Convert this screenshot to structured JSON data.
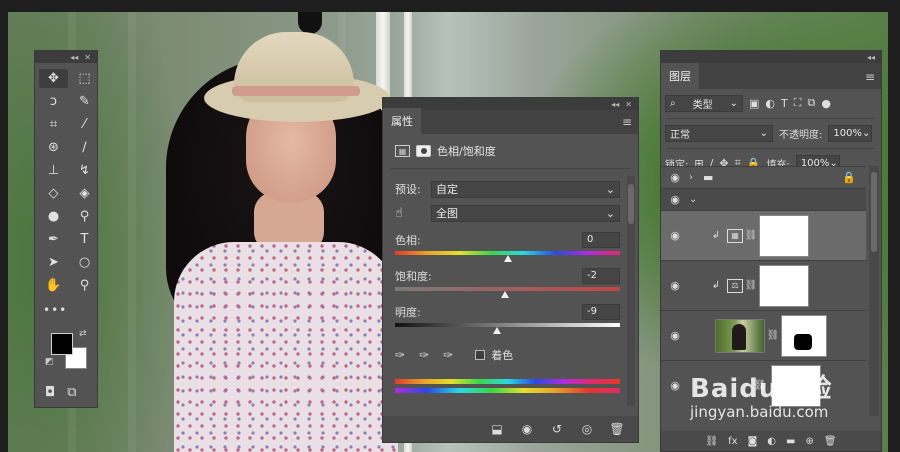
{
  "tools_panel": {
    "collapse_label": "◂◂",
    "close_label": "✕",
    "tools": [
      {
        "icon": "move-icon",
        "glyph": "✥",
        "active": true
      },
      {
        "icon": "marquee-icon",
        "glyph": "⬚"
      },
      {
        "icon": "lasso-icon",
        "glyph": "ↄ"
      },
      {
        "icon": "quick-select-icon",
        "glyph": "✎"
      },
      {
        "icon": "crop-icon",
        "glyph": "⌗"
      },
      {
        "icon": "eyedropper-icon",
        "glyph": "⁄"
      },
      {
        "icon": "healing-brush-icon",
        "glyph": "⊛"
      },
      {
        "icon": "brush-icon",
        "glyph": "∕"
      },
      {
        "icon": "clone-stamp-icon",
        "glyph": "⊥"
      },
      {
        "icon": "history-brush-icon",
        "glyph": "↯"
      },
      {
        "icon": "eraser-icon",
        "glyph": "◇"
      },
      {
        "icon": "paint-bucket-icon",
        "glyph": "◈"
      },
      {
        "icon": "blur-icon",
        "glyph": "●"
      },
      {
        "icon": "dodge-icon",
        "glyph": "⚲"
      },
      {
        "icon": "pen-icon",
        "glyph": "✒"
      },
      {
        "icon": "type-icon",
        "glyph": "T"
      },
      {
        "icon": "path-select-icon",
        "glyph": "➤"
      },
      {
        "icon": "shape-icon",
        "glyph": "○"
      },
      {
        "icon": "hand-icon",
        "glyph": "✋"
      },
      {
        "icon": "zoom-icon",
        "glyph": "⚲"
      }
    ],
    "more_label": "•••",
    "foreground_color": "#000000",
    "background_color": "#ffffff",
    "quick_mask_glyph": "◘",
    "screen_mode_glyph": "⧉"
  },
  "properties_panel": {
    "tab_label": "属性",
    "menu_glyph": "≡",
    "title": "色相/饱和度",
    "preset_label": "预设:",
    "preset_value": "自定",
    "channel_value": "全图",
    "hue_label": "色相:",
    "hue_value": "0",
    "saturation_label": "饱和度:",
    "saturation_value": "-2",
    "lightness_label": "明度:",
    "lightness_value": "-9",
    "colorize_label": "着色",
    "colorize_checked": false,
    "footer_icons": [
      "clip-to-layer-icon",
      "view-previous-icon",
      "reset-icon",
      "visibility-icon",
      "delete-icon"
    ]
  },
  "layers_panel": {
    "tab_label": "图层",
    "menu_glyph": "≡",
    "filter_kind": "类型",
    "blend_mode": "正常",
    "opacity_label": "不透明度:",
    "opacity_value": "100%",
    "lock_label": "锁定:",
    "fill_label": "填充:",
    "fill_value": "100%",
    "footer_icons": [
      "link-icon",
      "fx-icon",
      "mask-icon",
      "adjustment-icon",
      "group-icon",
      "new-layer-icon",
      "trash-icon"
    ]
  },
  "watermark": {
    "logo": "Baidu经验",
    "url": "jingyan.baidu.com"
  }
}
